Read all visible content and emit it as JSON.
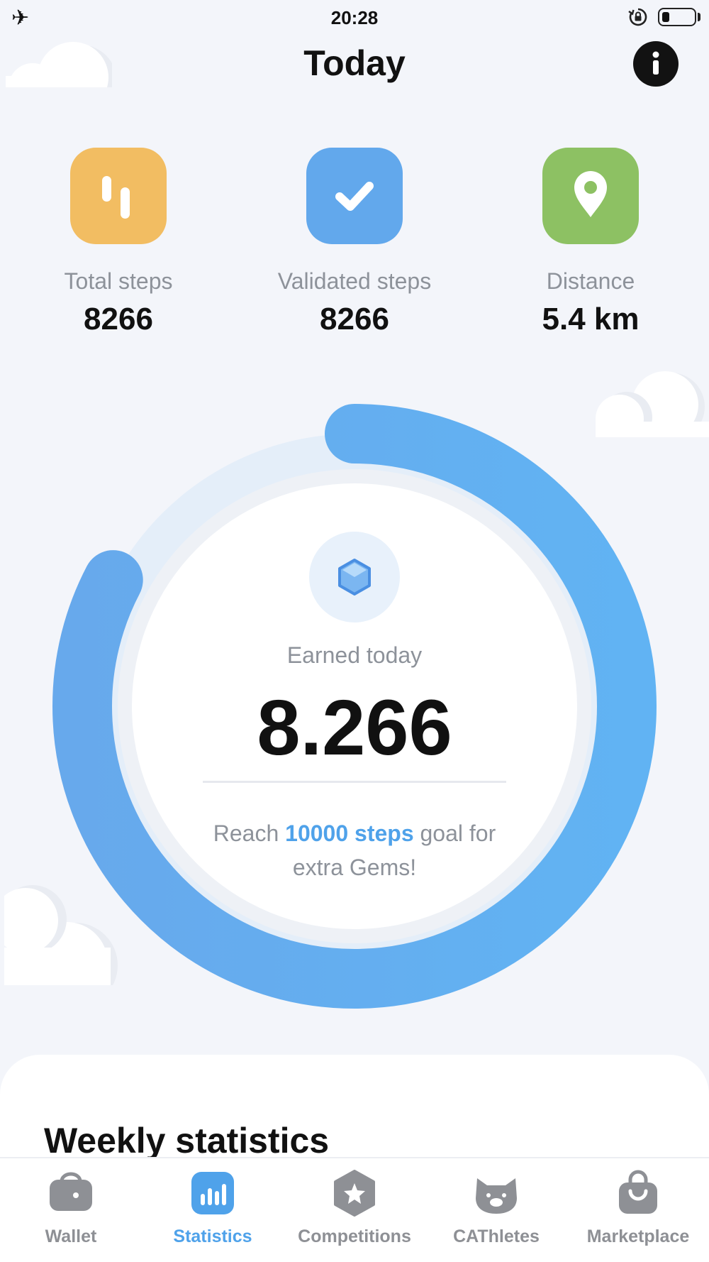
{
  "status_bar": {
    "time": "20:28",
    "airplane_icon": "airplane-icon",
    "rotation_lock_icon": "rotation-lock-icon",
    "battery_icon": "battery-icon"
  },
  "header": {
    "title": "Today",
    "info_icon": "info-icon"
  },
  "metrics": [
    {
      "label": "Total steps",
      "value": "8266",
      "icon": "bars-icon",
      "color": "#f2bd62"
    },
    {
      "label": "Validated steps",
      "value": "8266",
      "icon": "checkmark-icon",
      "color": "#62a8ec"
    },
    {
      "label": "Distance",
      "value": "5.4 km",
      "icon": "location-pin-icon",
      "color": "#8dc163"
    }
  ],
  "progress": {
    "steps": 8266,
    "goal": 10000,
    "fraction": 0.8266,
    "track_color": "#e3eef9",
    "fill_color": "#62aaef",
    "gem_icon": "gem-icon",
    "earned_label": "Earned today",
    "earned_value": "8.266",
    "goal_prefix": "Reach",
    "goal_highlight": "10000 steps",
    "goal_suffix": "goal for extra Gems!"
  },
  "weekly": {
    "title": "Weekly statistics"
  },
  "tabs": [
    {
      "label": "Wallet",
      "icon": "wallet-icon",
      "active": false
    },
    {
      "label": "Statistics",
      "icon": "bar-chart-icon",
      "active": true
    },
    {
      "label": "Competitions",
      "icon": "star-badge-icon",
      "active": false
    },
    {
      "label": "CAThletes",
      "icon": "cat-icon",
      "active": false
    },
    {
      "label": "Marketplace",
      "icon": "shopping-bag-icon",
      "active": false
    }
  ]
}
